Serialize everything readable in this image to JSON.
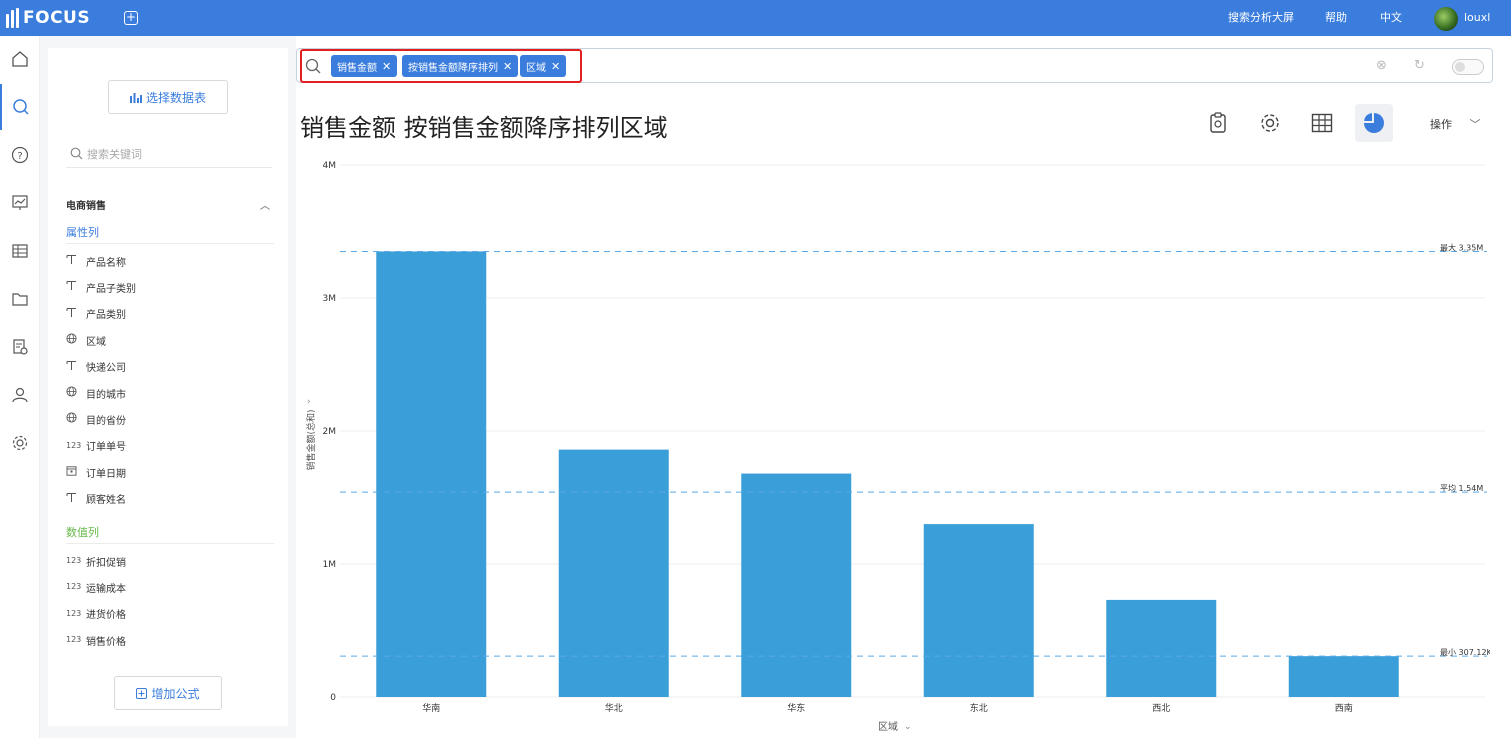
{
  "app": {
    "logo": "FOCUS",
    "add_tab_icon": "plus-square-icon"
  },
  "topnav": {
    "search_screen": "搜索分析大屏",
    "help": "帮助",
    "language": "中文",
    "user": "louxl"
  },
  "sidebar": {
    "select_table": "选择数据表",
    "search_placeholder": "搜索关键词",
    "group": "电商销售",
    "attr_section": "属性列",
    "num_section": "数值列",
    "attr_fields": [
      {
        "icon": "T",
        "label": "产品名称"
      },
      {
        "icon": "T",
        "label": "产品子类别"
      },
      {
        "icon": "T",
        "label": "产品类别"
      },
      {
        "icon": "globe",
        "label": "区域"
      },
      {
        "icon": "T",
        "label": "快递公司"
      },
      {
        "icon": "globe",
        "label": "目的城市"
      },
      {
        "icon": "globe",
        "label": "目的省份"
      },
      {
        "icon": "123",
        "label": "订单单号"
      },
      {
        "icon": "calendar",
        "label": "订单日期"
      },
      {
        "icon": "T",
        "label": "顾客姓名"
      }
    ],
    "num_fields": [
      {
        "icon": "123",
        "label": "折扣促销"
      },
      {
        "icon": "123",
        "label": "运输成本"
      },
      {
        "icon": "123",
        "label": "进货价格"
      },
      {
        "icon": "123",
        "label": "销售价格"
      }
    ],
    "add_formula": "增加公式"
  },
  "search": {
    "chips": [
      "销售金额",
      "按销售金额降序排列",
      "区域"
    ]
  },
  "result": {
    "title": "销售金额 按销售金额降序排列区域",
    "ops_label": "操作"
  },
  "chart_data": {
    "type": "bar",
    "categories": [
      "华南",
      "华北",
      "华东",
      "东北",
      "西北",
      "西南"
    ],
    "values": [
      3350000,
      1860000,
      1680000,
      1300000,
      730000,
      307120
    ],
    "ylim": [
      0,
      4000000
    ],
    "yticks": [
      0,
      1000000,
      2000000,
      3000000,
      4000000
    ],
    "ytick_labels": [
      "0",
      "1M",
      "2M",
      "3M",
      "4M"
    ],
    "xlabel": "区域",
    "ylabel": "销售金额(总和)",
    "reference_lines": [
      {
        "label": "最大 3.35M",
        "value": 3350000
      },
      {
        "label": "平均 1.54M",
        "value": 1540000
      },
      {
        "label": "最小 307.12K",
        "value": 307120
      }
    ],
    "bar_color": "#3a9fd8",
    "ref_line_color": "#5aa9e6"
  }
}
